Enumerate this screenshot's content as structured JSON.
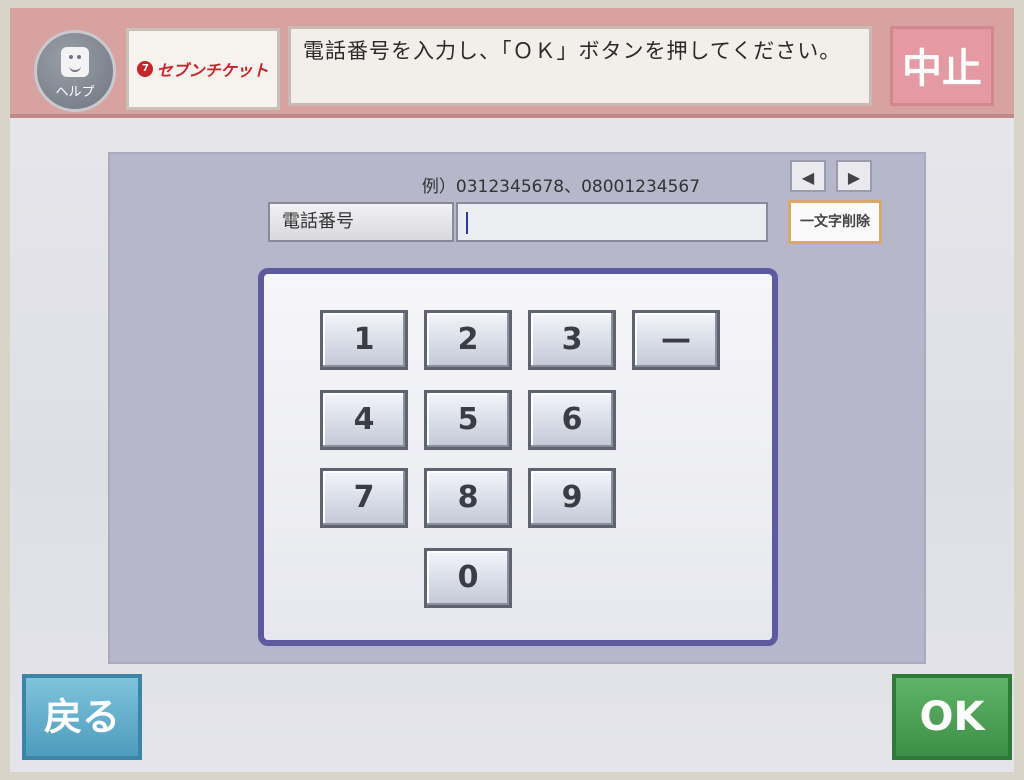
{
  "header": {
    "help_label": "ヘルプ",
    "logo_mark": "7",
    "logo_text": "セブンチケット",
    "message": "電話番号を入力し、「ＯＫ」ボタンを押してください。",
    "cancel_label": "中止"
  },
  "form": {
    "example_text": "例）0312345678、08001234567",
    "arrow_left": "◀",
    "arrow_right": "▶",
    "field_label": "電話番号",
    "field_value": "",
    "delete_label": "一文字削除"
  },
  "keypad": {
    "keys": [
      "1",
      "2",
      "3",
      "—",
      "4",
      "5",
      "6",
      "7",
      "8",
      "9",
      "0"
    ]
  },
  "footer": {
    "back_label": "戻る",
    "ok_label": "OK"
  },
  "colors": {
    "header_bg": "#d7a2a0",
    "cancel_bg": "#e59aa3",
    "back_bg": "#4e9cbd",
    "ok_bg": "#3d8f46",
    "keypad_border": "#5e5aa0"
  }
}
